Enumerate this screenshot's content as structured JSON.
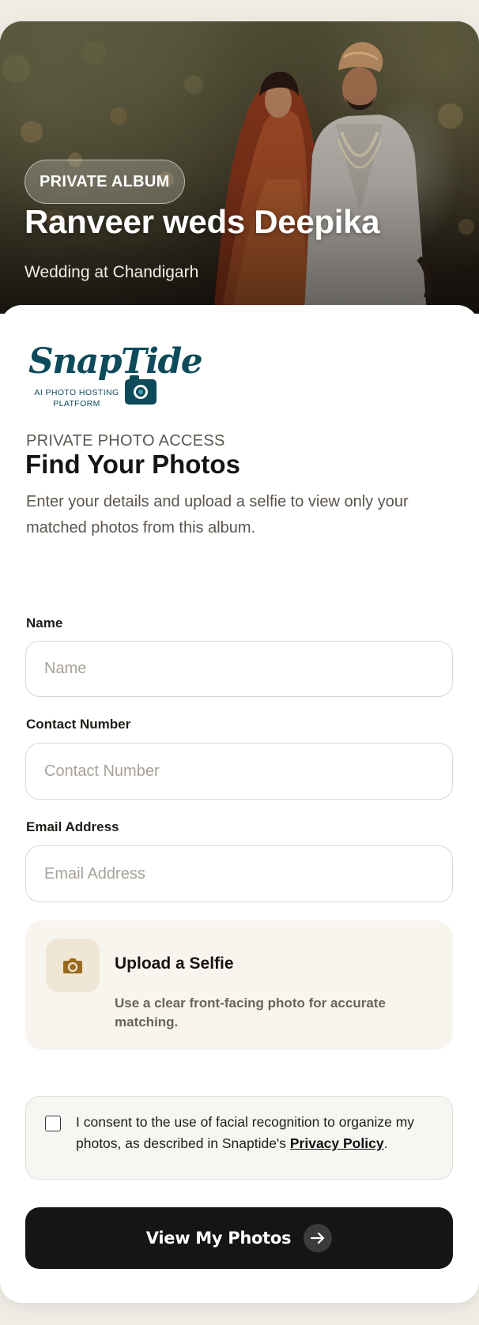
{
  "hero": {
    "badge": "PRIVATE ALBUM",
    "title": "Ranveer weds Deepika",
    "subtitle": "Wedding at Chandigarh"
  },
  "logo": {
    "wordmark": "SnapTide",
    "tagline": "AI PHOTO HOSTING PLATFORM"
  },
  "intro": {
    "eyebrow": "PRIVATE PHOTO ACCESS",
    "title": "Find Your Photos",
    "description": "Enter your details and upload a selfie to view only your matched photos from this album."
  },
  "form": {
    "name": {
      "label": "Name",
      "placeholder": "Name",
      "value": ""
    },
    "contact": {
      "label": "Contact Number",
      "placeholder": "Contact Number",
      "value": ""
    },
    "email": {
      "label": "Email Address",
      "placeholder": "Email Address",
      "value": ""
    }
  },
  "upload": {
    "icon": "camera-icon",
    "title": "Upload a Selfie",
    "hint": "Use a clear front-facing photo for accurate matching."
  },
  "consent": {
    "checked": false,
    "text": "I consent to the use of facial recognition to organize my photos, as described in Snaptide's ",
    "link": "Privacy Policy",
    "suffix": "."
  },
  "cta": {
    "label": "View My Photos",
    "icon": "arrow-right-icon"
  },
  "colors": {
    "brand": "#0d4a5a",
    "cta": "#151515",
    "upload_accent": "#9a6a1f",
    "upload_bg": "#f8f5ee"
  }
}
